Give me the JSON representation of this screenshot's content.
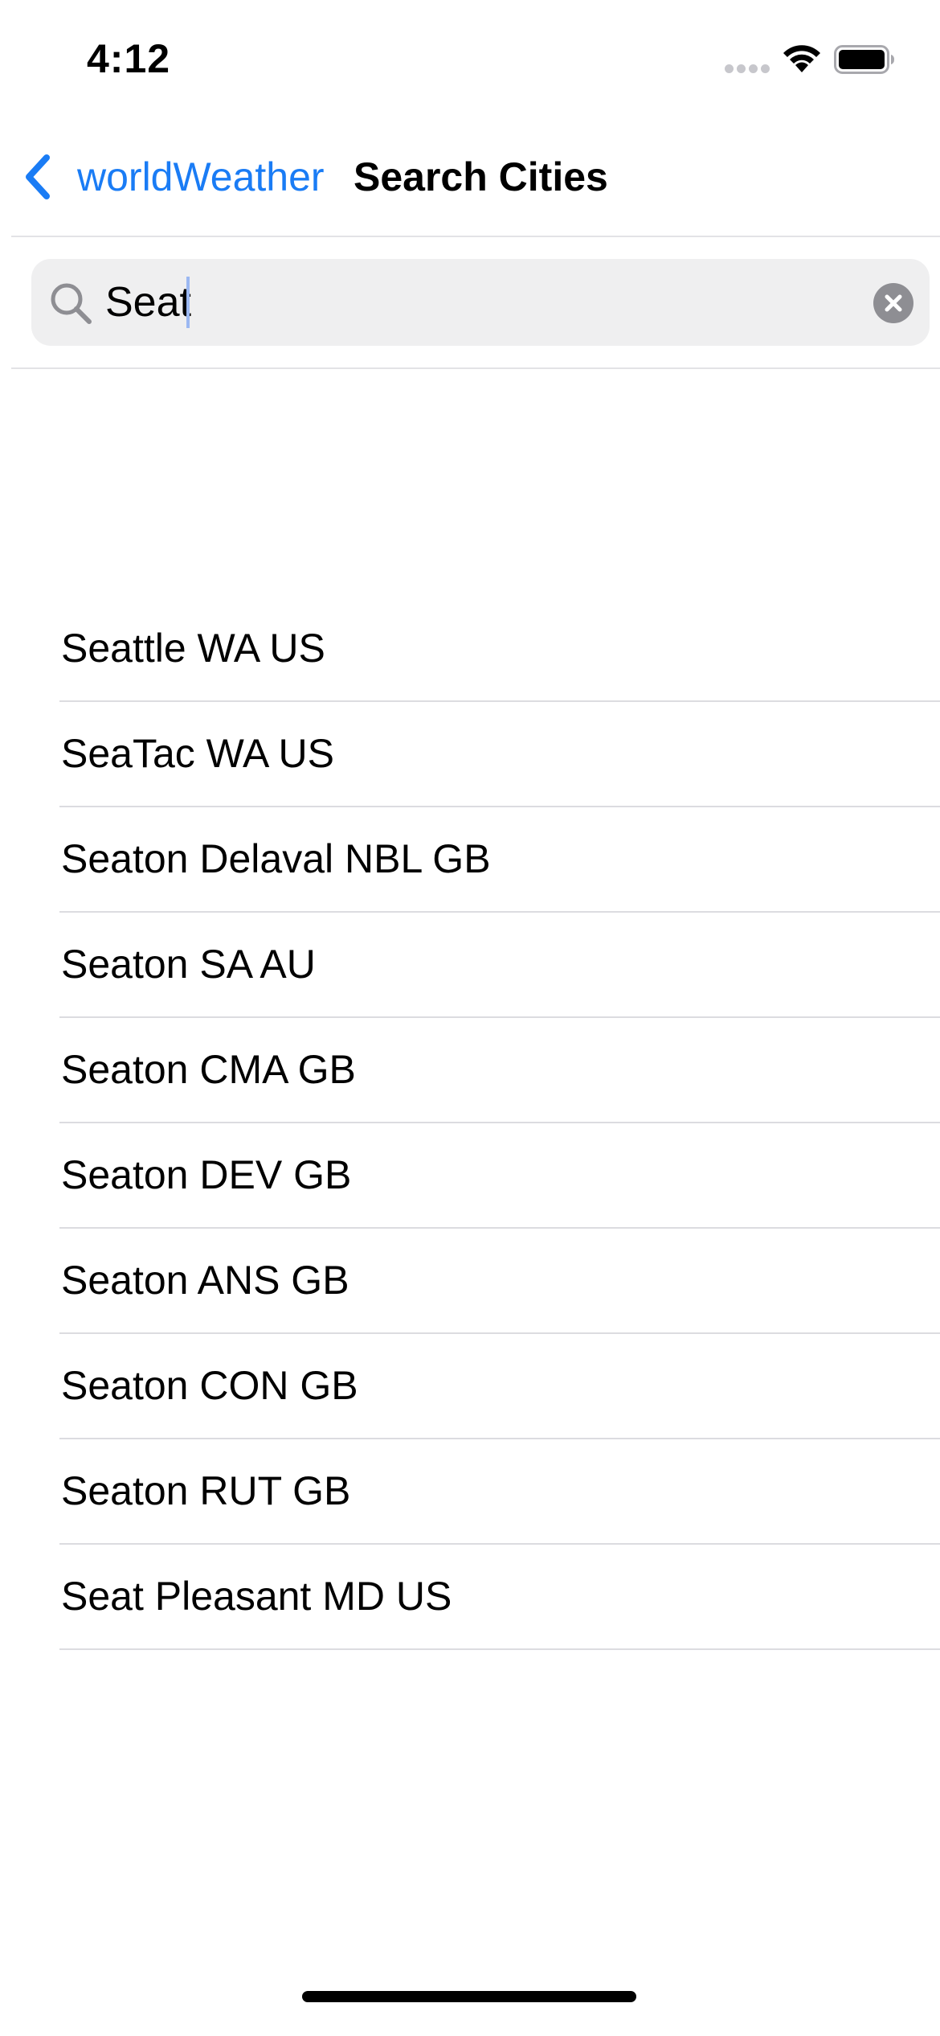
{
  "status_bar": {
    "time": "4:12"
  },
  "nav": {
    "back_label": "worldWeather",
    "title": "Search Cities"
  },
  "search": {
    "value": "Seat"
  },
  "results": [
    {
      "label": "Seattle WA US"
    },
    {
      "label": "SeaTac WA US"
    },
    {
      "label": "Seaton Delaval NBL GB"
    },
    {
      "label": "Seaton SA AU"
    },
    {
      "label": "Seaton CMA GB"
    },
    {
      "label": "Seaton DEV GB"
    },
    {
      "label": "Seaton ANS GB"
    },
    {
      "label": "Seaton CON GB"
    },
    {
      "label": "Seaton RUT GB"
    },
    {
      "label": "Seat Pleasant MD US"
    }
  ],
  "icons": {
    "back": "chevron-left-icon",
    "search": "magnifying-glass-icon",
    "clear": "clear-x-circle-icon",
    "wifi": "wifi-icon",
    "battery": "battery-icon",
    "signal": "cellular-signal-icon"
  },
  "colors": {
    "accent": "#1a7cf5",
    "search_field_bg": "#efeff0",
    "separator": "#dcdce0",
    "clear_button": "#8e8e93"
  }
}
